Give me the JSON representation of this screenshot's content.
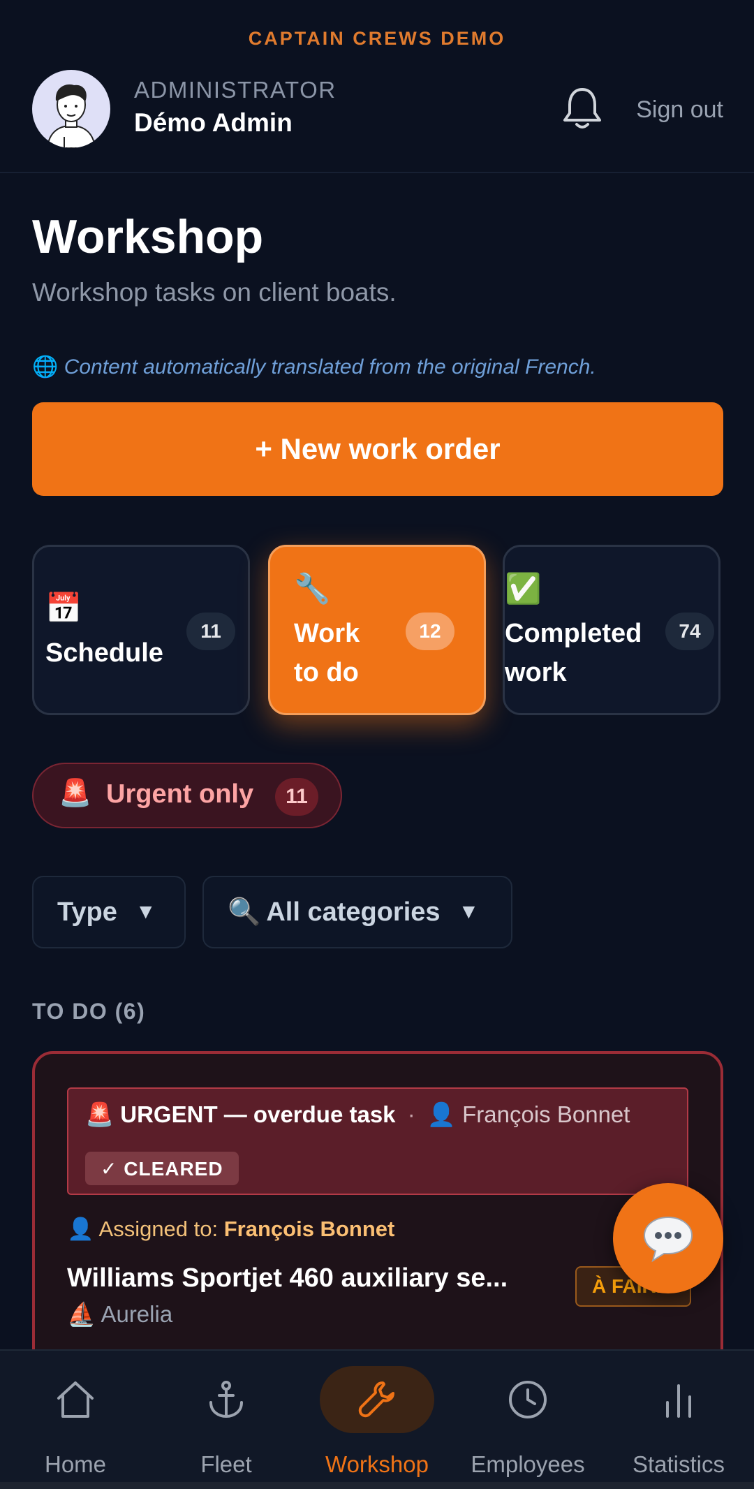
{
  "app": {
    "brand": "CAPTAIN CREWS DEMO"
  },
  "user": {
    "role": "ADMINISTRATOR",
    "name": "Démo Admin"
  },
  "header": {
    "sign_out": "Sign out"
  },
  "page": {
    "title": "Workshop",
    "subtitle": "Workshop tasks on client boats.",
    "translation_notice": "Content automatically translated from the original French."
  },
  "actions": {
    "new_work_order": "+ New work order"
  },
  "tiles": [
    {
      "emoji": "📅",
      "label": "Schedule",
      "count": "11"
    },
    {
      "emoji": "🔧",
      "label_line1": "Work",
      "label_line2": "to do",
      "count": "12"
    },
    {
      "emoji": "✅",
      "label_line1": "Completed",
      "label_line2": "work",
      "count": "74"
    }
  ],
  "urgent_filter": {
    "emoji": "🚨",
    "label": "Urgent only",
    "count": "11"
  },
  "filters": {
    "type": {
      "label": "Type",
      "arrow": "▼"
    },
    "category": {
      "emoji": "🔍",
      "label": "All categories",
      "arrow": "▼"
    }
  },
  "section": {
    "title": "TO DO (6)"
  },
  "task": {
    "alert_emoji": "🚨",
    "alert_title": "URGENT — overdue task",
    "alert_separator": "·",
    "alert_person_emoji": "👤",
    "alert_person": "François Bonnet",
    "cleared_label": "✓ CLEARED",
    "assigned_emoji": "👤",
    "assigned_prefix": "Assigned to: ",
    "assigned_name": "François Bonnet",
    "title": "Williams Sportjet 460 auxiliary se...",
    "boat_emoji": "⛵",
    "boat": "Aurelia",
    "status": "À FAIRE"
  },
  "nav": [
    {
      "label": "Home",
      "icon": "home-icon"
    },
    {
      "label": "Fleet",
      "icon": "anchor-icon"
    },
    {
      "label": "Workshop",
      "icon": "wrench-icon"
    },
    {
      "label": "Employees",
      "icon": "clock-icon"
    },
    {
      "label": "Statistics",
      "icon": "bar-chart-icon"
    }
  ],
  "colors": {
    "accent": "#f07316",
    "background": "#0b1120",
    "urgent": "#9b2c36"
  }
}
